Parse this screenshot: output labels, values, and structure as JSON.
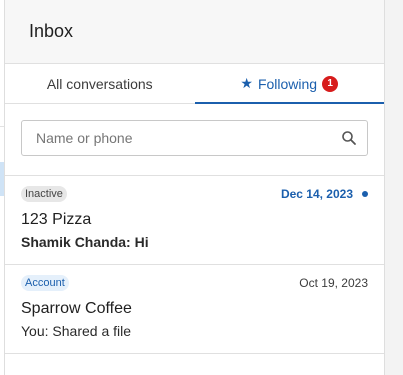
{
  "header": {
    "title": "Inbox"
  },
  "tabs": [
    {
      "label": "All conversations",
      "active": false
    },
    {
      "label": "Following",
      "active": true,
      "icon": "star-icon",
      "badge": "1"
    }
  ],
  "search": {
    "placeholder": "Name or phone",
    "value": "",
    "icon": "search-icon"
  },
  "conversations": [
    {
      "tag": "Inactive",
      "tag_color": "#e7e7e7",
      "name": "123 Pizza",
      "preview": "Shamik Chanda: Hi",
      "date": "Dec 14, 2023",
      "unread": true
    },
    {
      "tag": "Account",
      "tag_color": "#e5f0fb",
      "name": "Sparrow Coffee",
      "preview": "You: Shared a file",
      "date": "Oct 19, 2023",
      "unread": false
    }
  ],
  "colors": {
    "accent": "#1b5fad",
    "badge": "#d71c1c",
    "header_bg": "#f7f7f7"
  }
}
